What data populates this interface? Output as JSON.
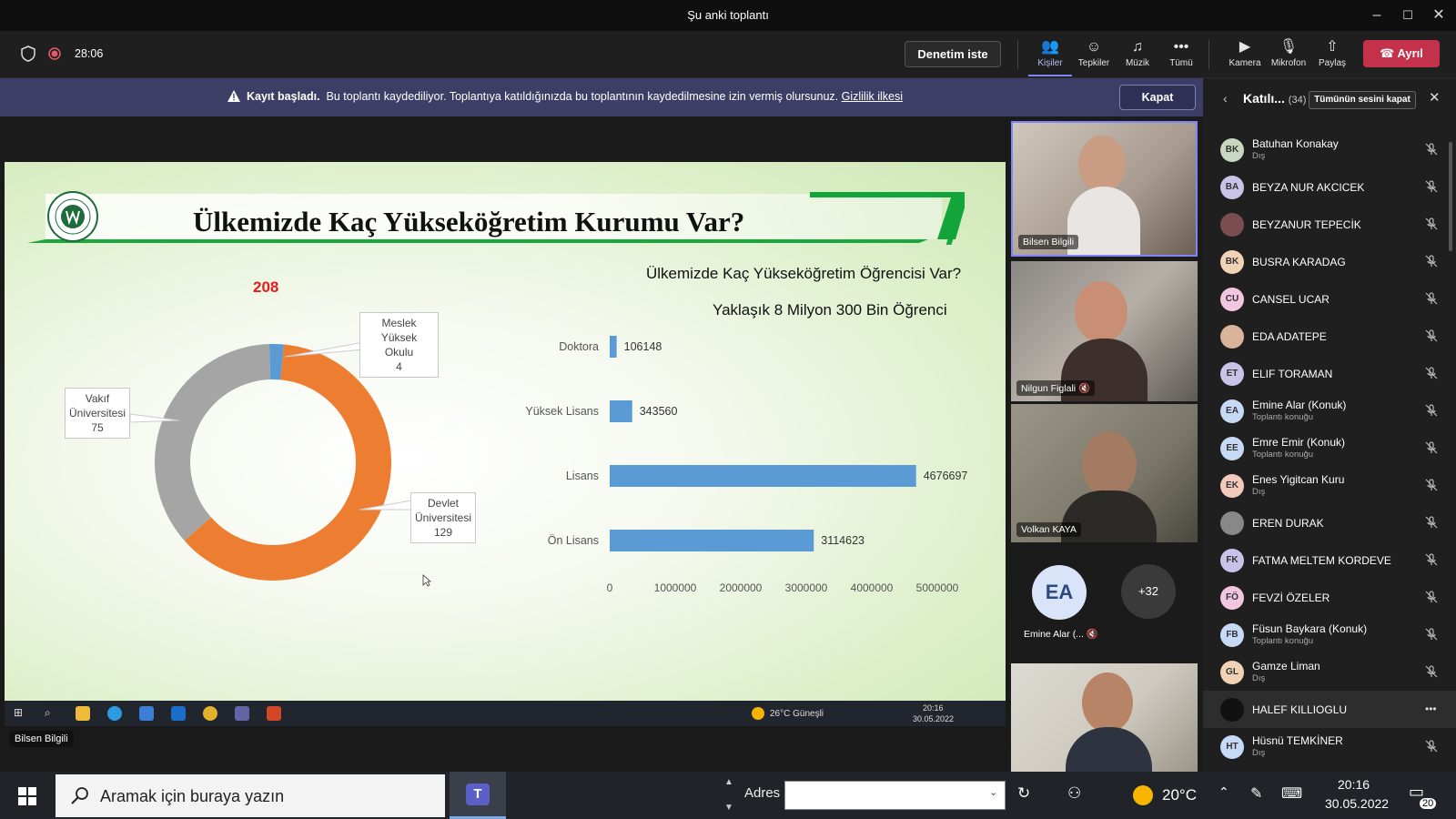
{
  "window": {
    "title": "Şu anki toplantı"
  },
  "meeting": {
    "timer": "28:06"
  },
  "toolbar": {
    "request_control": "Denetim iste",
    "people": "Kişiler",
    "reactions": "Tepkiler",
    "music": "Müzik",
    "more": "Tümü",
    "camera": "Kamera",
    "mic": "Mikrofon",
    "share": "Paylaş",
    "leave": "Ayrıl"
  },
  "banner": {
    "bold": "Kayıt başladı.",
    "text": "Bu toplantı kaydediliyor. Toplantıya katıldığınızda bu toplantının kaydedilmesine izin vermiş olursunuz.",
    "link": "Gizlilik ilkesi",
    "close": "Kapat"
  },
  "slide": {
    "title": "Ülkemizde Kaç Yükseköğretim Kurumu Var?",
    "total": "208",
    "subtitle1": "Ülkemizde Kaç Yükseköğretim Öğrencisi Var?",
    "subtitle2": "Yaklaşık 8 Milyon 300 Bin Öğrenci",
    "callouts": {
      "meslek": [
        "Meslek Yüksek",
        "Okulu",
        "4"
      ],
      "vakif": [
        "Vakıf",
        "Üniversitesi",
        "75"
      ],
      "devlet": [
        "Devlet",
        "Üniversitesi",
        "129"
      ]
    }
  },
  "chart_data": [
    {
      "type": "pie",
      "categories": [
        "Devlet Üniversitesi",
        "Vakıf Üniversitesi",
        "Meslek Yüksek Okulu"
      ],
      "values": [
        129,
        75,
        4
      ],
      "colors": [
        "#ed7d31",
        "#a5a5a5",
        "#5b9bd5"
      ],
      "title": "208"
    },
    {
      "type": "bar",
      "orientation": "horizontal",
      "title": "Ülkemizde Kaç Yükseköğretim Öğrencisi Var?",
      "categories": [
        "Doktora",
        "Yüksek Lisans",
        "Lisans",
        "Ön Lisans"
      ],
      "values": [
        106148,
        343560,
        4676697,
        3114623
      ],
      "xlim": [
        0,
        5000000
      ],
      "xticks": [
        "0",
        "1000000",
        "2000000",
        "3000000",
        "4000000",
        "5000000"
      ],
      "color": "#5b9bd5"
    }
  ],
  "inner_taskbar": {
    "weather": "26°C  Güneşli",
    "time": "20:16",
    "date": "30.05.2022"
  },
  "presenter": {
    "name": "Bilsen Bilgili"
  },
  "videos": [
    {
      "name": "Bilsen Bilgili"
    },
    {
      "name": "Nilgun Figlali"
    },
    {
      "name": "Volkan KAYA"
    }
  ],
  "overflow": {
    "initials": "EA",
    "name": "Emine Alar (...",
    "more": "+32"
  },
  "participants": {
    "title": "Katılı...",
    "count": "(34)",
    "mute_all": "Tümünün sesini kapat",
    "items": [
      {
        "initials": "BK",
        "name": "Batuhan Konakay",
        "sub": "Dış",
        "color": "#c8d8c0"
      },
      {
        "initials": "BA",
        "name": "BEYZA NUR AKCICEK",
        "sub": "",
        "color": "#c9c3e8"
      },
      {
        "initials": "",
        "name": "BEYZANUR TEPECİK",
        "sub": "",
        "color": "#7a4e4e"
      },
      {
        "initials": "BK",
        "name": "BUSRA KARADAG",
        "sub": "",
        "color": "#f0d3b4"
      },
      {
        "initials": "CU",
        "name": "CANSEL UCAR",
        "sub": "",
        "color": "#f2c6e0"
      },
      {
        "initials": "",
        "name": "EDA ADATEPE",
        "sub": "",
        "color": "#d9b39a"
      },
      {
        "initials": "ET",
        "name": "ELIF TORAMAN",
        "sub": "",
        "color": "#c9c3e8"
      },
      {
        "initials": "EA",
        "name": "Emine Alar (Konuk)",
        "sub": "Toplantı konuğu",
        "color": "#c7daf5"
      },
      {
        "initials": "EE",
        "name": "Emre Emir (Konuk)",
        "sub": "Toplantı konuğu",
        "color": "#c7daf5"
      },
      {
        "initials": "EK",
        "name": "Enes Yigitcan Kuru",
        "sub": "Dış",
        "color": "#f4c9bd"
      },
      {
        "initials": "",
        "name": "EREN DURAK",
        "sub": "",
        "color": "#888888"
      },
      {
        "initials": "FK",
        "name": "FATMA MELTEM KORDEVE",
        "sub": "",
        "color": "#c9c3e8"
      },
      {
        "initials": "FÖ",
        "name": "FEVZİ ÖZELER",
        "sub": "",
        "color": "#f2c6e0"
      },
      {
        "initials": "FB",
        "name": "Füsun Baykara (Konuk)",
        "sub": "Toplantı konuğu",
        "color": "#c7daf5"
      },
      {
        "initials": "GL",
        "name": "Gamze Liman",
        "sub": "Dış",
        "color": "#f0d3b4"
      },
      {
        "initials": "",
        "name": "HALEF KILLIOGLU",
        "sub": "",
        "color": "#111111"
      },
      {
        "initials": "HT",
        "name": "Hüsnü TEMKİNER",
        "sub": "Dış",
        "color": "#c7daf5"
      }
    ]
  },
  "taskbar": {
    "search_placeholder": "Aramak için buraya yazın",
    "address_label": "Adres",
    "temp": "20°C",
    "time": "20:16",
    "date": "30.05.2022",
    "notif": "20"
  }
}
